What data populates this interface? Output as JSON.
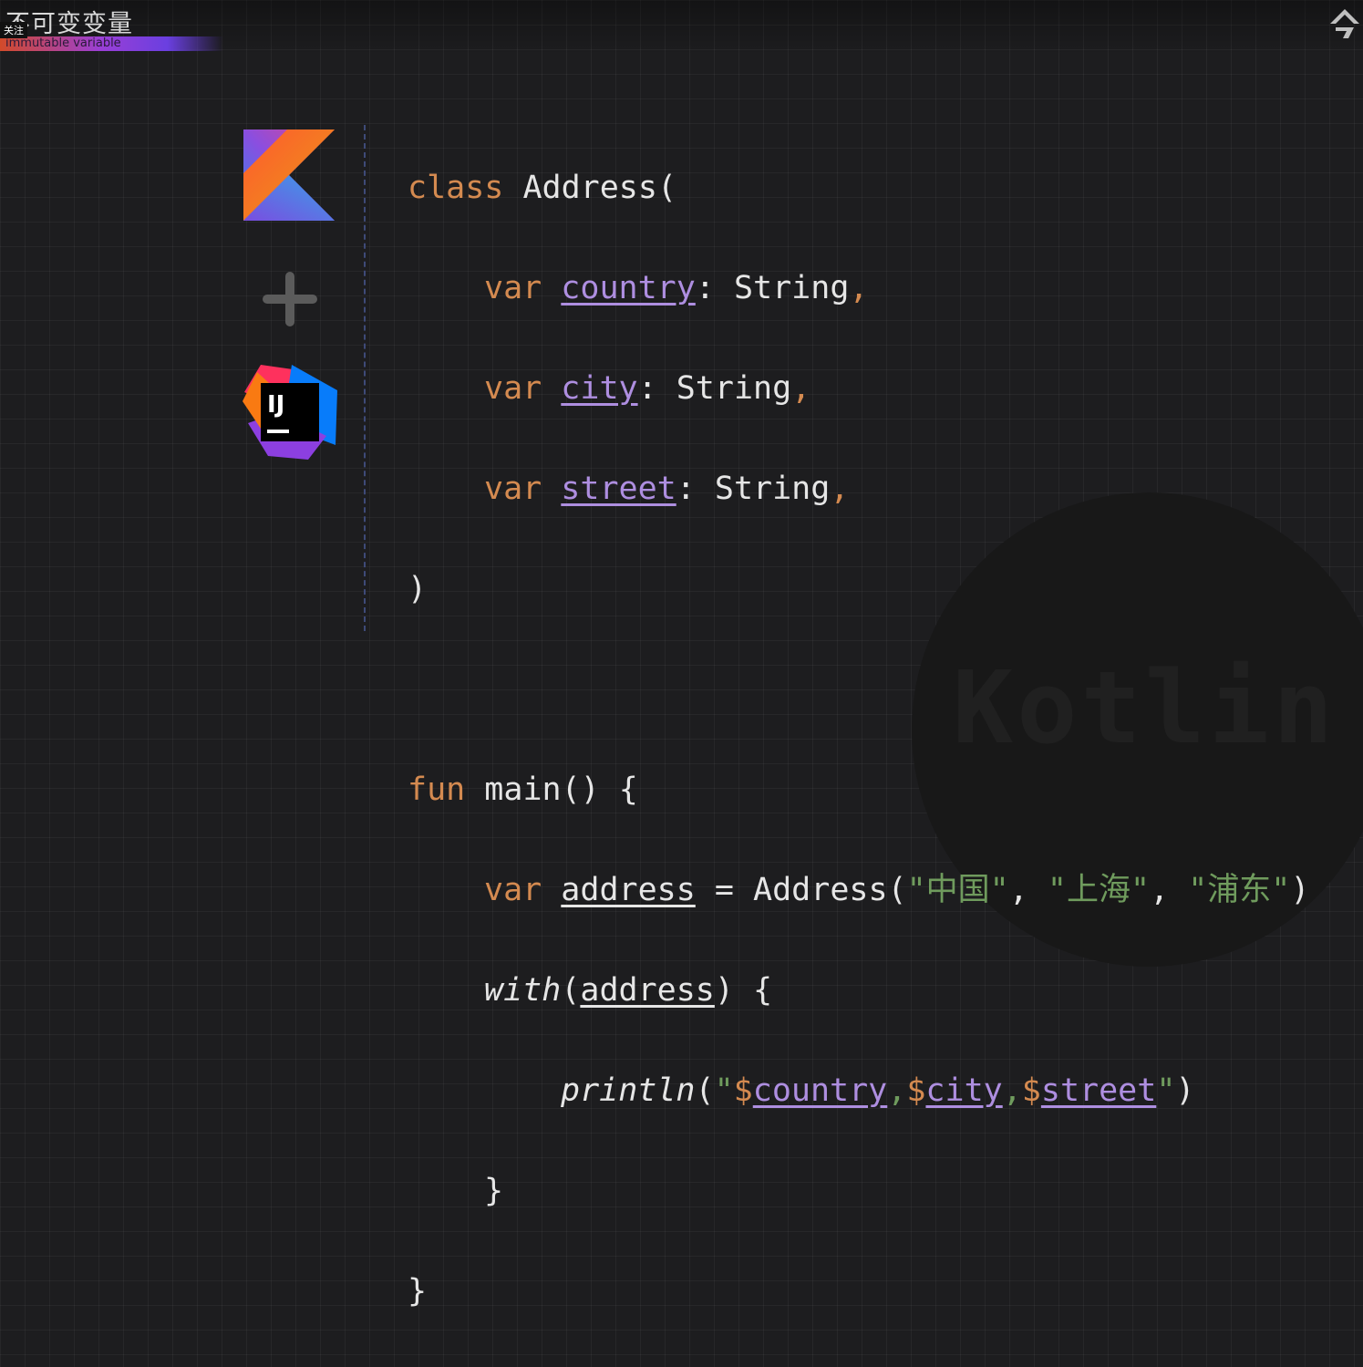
{
  "header": {
    "title": "不可变变量",
    "follow_label": "关注",
    "subtitle": "immutable variable"
  },
  "icons": [
    "share-icon",
    "kotlin-logo",
    "plus-icon",
    "intellij-logo"
  ],
  "colors": {
    "background": "#1d1d1f",
    "keyword": "#d48a50",
    "property": "#ae8ee0",
    "string": "#6f9b5d",
    "text": "#e6e6e6"
  },
  "watermark": "Kotlin",
  "code": {
    "l1": {
      "kw": "class",
      "rest": "Address("
    },
    "l2": {
      "kw": "var",
      "name": "country",
      "type": ": String",
      "comma": ","
    },
    "l3": {
      "kw": "var",
      "name": "city",
      "type": ": String",
      "comma": ","
    },
    "l4": {
      "kw": "var",
      "name": "street",
      "type": ": String",
      "comma": ","
    },
    "l5": ")",
    "l7": {
      "kw": "fun",
      "rest": "main() {"
    },
    "l8": {
      "kw": "var",
      "name": "address",
      "eq": " = Address(",
      "s1": "\"中国\"",
      "c1": ", ",
      "s2": "\"上海\"",
      "c2": ", ",
      "s3": "\"浦东\"",
      "end": ")"
    },
    "l9": {
      "fn": "with",
      "open": "(",
      "arg": "address",
      "close": ") {"
    },
    "l10": {
      "fn": "println",
      "open": "(",
      "q1": "\"",
      "d1": "$",
      "v1": "country",
      "sep1": ",",
      "d2": "$",
      "v2": "city",
      "sep2": ",",
      "d3": "$",
      "v3": "street",
      "q2": "\"",
      "close": ")"
    },
    "l11": "}",
    "l12": "}"
  }
}
